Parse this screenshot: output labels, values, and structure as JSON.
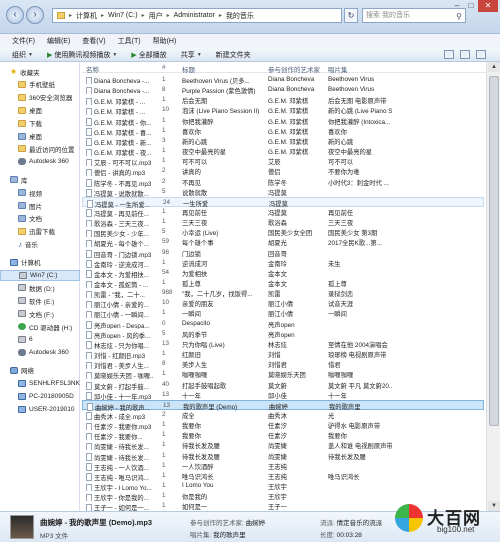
{
  "address": {
    "segments": [
      "计算机",
      "Win7 (C:)",
      "用户",
      "Administrator",
      "我的音乐"
    ],
    "search_placeholder": "搜索 我的音乐"
  },
  "menu": [
    "文件(F)",
    "编辑(E)",
    "查看(V)",
    "工具(T)",
    "帮助(H)"
  ],
  "toolbar": {
    "organize": "组织",
    "play_with": "使用腾讯视频播放",
    "play_all": "全部播放",
    "share": "共享",
    "new_folder": "新建文件夹"
  },
  "sidebar": [
    {
      "label": "收藏夹",
      "level": "group",
      "icon": "star"
    },
    {
      "label": "手机壁纸",
      "level": "child",
      "icon": "folder"
    },
    {
      "label": "360安全浏览器",
      "level": "child",
      "icon": "folder"
    },
    {
      "label": "桌面",
      "level": "child",
      "icon": "folder"
    },
    {
      "label": "下载",
      "level": "child",
      "icon": "folder"
    },
    {
      "label": "桌面",
      "level": "child",
      "icon": "lib"
    },
    {
      "label": "最近访问的位置",
      "level": "child",
      "icon": "folder"
    },
    {
      "label": "Autodesk 360",
      "level": "child",
      "icon": "cloud"
    },
    {
      "label": "库",
      "level": "group",
      "icon": "lib"
    },
    {
      "label": "视频",
      "level": "child",
      "icon": "lib"
    },
    {
      "label": "图片",
      "level": "child",
      "icon": "lib"
    },
    {
      "label": "文档",
      "level": "child",
      "icon": "lib"
    },
    {
      "label": "迅雷下载",
      "level": "child",
      "icon": "folder"
    },
    {
      "label": "音乐",
      "level": "child",
      "icon": "music"
    },
    {
      "label": "计算机",
      "level": "group",
      "icon": "pc"
    },
    {
      "label": "Win7 (C:)",
      "level": "child",
      "icon": "drive"
    },
    {
      "label": "数据 (D:)",
      "level": "child",
      "icon": "drive"
    },
    {
      "label": "软件 (E:)",
      "level": "child",
      "icon": "drive"
    },
    {
      "label": "文档 (F:)",
      "level": "child",
      "icon": "drive"
    },
    {
      "label": "CD 驱动器 (H:)",
      "level": "child",
      "icon": "green"
    },
    {
      "label": "6",
      "level": "child",
      "icon": "drive"
    },
    {
      "label": "Autodesk 360",
      "level": "child",
      "icon": "cloud"
    },
    {
      "label": "网络",
      "level": "group",
      "icon": "net"
    },
    {
      "label": "SENHLRFSL3NK",
      "level": "child",
      "icon": "pc"
    },
    {
      "label": "PC-20180905D",
      "level": "child",
      "icon": "pc"
    },
    {
      "label": "USER-2019010",
      "level": "child",
      "icon": "pc"
    }
  ],
  "columns": {
    "name": "名称",
    "num": "#",
    "title": "标题",
    "artist": "参与创作的艺术家",
    "album": "唱片集"
  },
  "rows": [
    {
      "name": "Diana Boncheva -...",
      "num": "1",
      "title": "Beethoven Virus (贝多...",
      "artist": "Diana Boncheva",
      "album": "Beethoven Virus"
    },
    {
      "name": "Diana Boncheva -...",
      "num": "8",
      "title": "Purple Passion (紫色激情)",
      "artist": "Diana Boncheva",
      "album": "Beethoven Virus"
    },
    {
      "name": "G.E.M. 邓紫棋 - ...",
      "num": "1",
      "title": "后会无期",
      "artist": "G.E.M. 邓紫棋",
      "album": "后会无期 电影原声带"
    },
    {
      "name": "G.E.M. 邓紫棋 - ...",
      "num": "10",
      "title": "泡沫 (Live Piano Session II)",
      "artist": "G.E.M. 邓紫棋",
      "album": "新的心跳 (Live Piano Sessi..."
    },
    {
      "name": "G.E.M. 邓紫棋 - 你...",
      "num": "1",
      "title": "你把我灌醉",
      "artist": "G.E.M. 邓紫棋",
      "album": "你把我灌醉 (Intoxica..."
    },
    {
      "name": "G.E.M. 邓紫棋 - 喜...",
      "num": "1",
      "title": "喜欢你",
      "artist": "G.E.M. 邓紫棋",
      "album": "喜欢你"
    },
    {
      "name": "G.E.M. 邓紫棋 - 新...",
      "num": "3",
      "title": "新的心跳",
      "artist": "G.E.M. 邓紫棋",
      "album": "新的心跳"
    },
    {
      "name": "G.E.M. 邓紫棋 - 夜...",
      "num": "1",
      "title": "夜空中最亮的星",
      "artist": "G.E.M. 邓紫棋",
      "album": "夜空中最亮的星"
    },
    {
      "name": "艾辰 - 可不可以.mp3",
      "num": "1",
      "title": "可不可以",
      "artist": "艾辰",
      "album": "可不可以"
    },
    {
      "name": "僧侣 - 讲真的.mp3",
      "num": "2",
      "title": "讲真的",
      "artist": "僧侣",
      "album": "不要你为难"
    },
    {
      "name": "陈学冬 - 不再见.mp3",
      "num": "2",
      "title": "不再见",
      "artist": "陈学冬",
      "album": "小时代3：刺金时代 ..."
    },
    {
      "name": "冯提莫 - 说散就散...",
      "num": "5",
      "title": "说散就散",
      "artist": "冯提莫",
      "album": ""
    },
    {
      "name": "冯提莫 - 一生所爱...",
      "num": "24",
      "title": "一生所爱",
      "artist": "冯提莫",
      "album": ""
    },
    {
      "name": "冯提莫 - 再见前任...",
      "num": "1",
      "title": "再见前任",
      "artist": "冯提莫",
      "album": "再见前任"
    },
    {
      "name": "歌浴森 - 三天三夜...",
      "num": "1",
      "title": "三天三夜",
      "artist": "歌浴森",
      "album": "三天三夜"
    },
    {
      "name": "国民美少女 - 少年...",
      "num": "5",
      "title": "小幸运 (Live)",
      "artist": "国民美少女全团",
      "album": "国民美少女 第3期"
    },
    {
      "name": "胡夏光 - 每个雄个...",
      "num": "59",
      "title": "每个雄个事",
      "artist": "胡夏光",
      "album": "2017全民K歌...第..."
    },
    {
      "name": "回音哥 - 门边锁.mp3",
      "num": "98",
      "title": "门边锁",
      "artist": "回音哥",
      "album": ""
    },
    {
      "name": "金南玲 - 逆流成河...",
      "num": "1",
      "title": "逆流成河",
      "artist": "金南玲",
      "album": "未生"
    },
    {
      "name": "金本文 - 为爱相扶...",
      "num": "54",
      "title": "为爱相扶",
      "artist": "金本文",
      "album": ""
    },
    {
      "name": "金本文 - 孤蛇筒 - ...",
      "num": "1",
      "title": "孤上尊",
      "artist": "金本文",
      "album": "孤上尊"
    },
    {
      "name": "凯雷 - \"我，二十...",
      "num": "988",
      "title": "\"我，二十几岁，找饭得...",
      "artist": "凯雷",
      "album": "录狱剑恋"
    },
    {
      "name": "丽江小倩 - 亲爱的...",
      "num": "10",
      "title": "亲爱的朋友",
      "artist": "丽江小倩",
      "album": "试音天涯"
    },
    {
      "name": "丽江小倩 - 一瞬间...",
      "num": "1",
      "title": "一瞬间",
      "artist": "丽江小倩",
      "album": "一瞬间"
    },
    {
      "name": "亮声open - Despa...",
      "num": "0",
      "title": "Despacito",
      "artist": "亮声open",
      "album": ""
    },
    {
      "name": "亮声open - 风的季...",
      "num": "5",
      "title": "风的季节",
      "artist": "亮声open",
      "album": ""
    },
    {
      "name": "林志炫 - 只为你唱...",
      "num": "13",
      "title": "只为你唱 (Live)",
      "artist": "林志炫",
      "album": "至情在他 2004演唱会"
    },
    {
      "name": "刘惜 - 红颜旧.mp3",
      "num": "1",
      "title": "红颜旧",
      "artist": "刘惜",
      "album": "琅琊榜 电视剧原声带"
    },
    {
      "name": "刘惜君 - 美步人生...",
      "num": "8",
      "title": "美步人生",
      "artist": "刘惜君",
      "album": "惜君"
    },
    {
      "name": "莫晓娱乐天团 - 咖喱...",
      "num": "1",
      "title": "咖喱咖喱",
      "artist": "莫晓娱乐天团",
      "album": "咖喱咖喱"
    },
    {
      "name": "莫文蔚 - 打起手鼓...",
      "num": "40",
      "title": "打起手鼓唱起歌",
      "artist": "莫文蔚",
      "album": "莫文蔚 平凡 莫文蔚20..."
    },
    {
      "name": "邱小佳 - 十一年.mp3",
      "num": "13",
      "title": "十一年",
      "artist": "邱小佳",
      "album": "十一年"
    },
    {
      "name": "曲婉婷 - 我的歌声...",
      "num": "13",
      "title": "我的歌声里 (Demo)",
      "artist": "曲婉婷",
      "album": "我的歌声里"
    },
    {
      "name": "曲秀沐 - 成全.mp3",
      "num": "2",
      "title": "成全",
      "artist": "曲秀沐",
      "album": "光"
    },
    {
      "name": "任素汐 - 我要你.mp3",
      "num": "1",
      "title": "我要你",
      "artist": "任素汐",
      "album": "驴得水 电影原声带"
    },
    {
      "name": "任素汐 - 我要你...",
      "num": "1",
      "title": "我要你",
      "artist": "任素汐",
      "album": "我要你"
    },
    {
      "name": "尚雯婕 - 待我长发...",
      "num": "1",
      "title": "待我长发及腰",
      "artist": "尚雯婕",
      "album": "盖人和谁 电视剧原声带"
    },
    {
      "name": "尚雯婕 - 待我长发...",
      "num": "1",
      "title": "待我长发及腰",
      "artist": "尚雯婕",
      "album": "待我长发及腰"
    },
    {
      "name": "王志纯 - 一人饮酒...",
      "num": "1",
      "title": "一人饮酒醉",
      "artist": "王志纯",
      "album": ""
    },
    {
      "name": "王志纯 - 唯马识鸿...",
      "num": "1",
      "title": "唯马识鸿长",
      "artist": "王志纯",
      "album": "唯马识鸿长"
    },
    {
      "name": "王欣宇 - I Lomo Yo...",
      "num": "1",
      "title": "I Lomo You",
      "artist": "王欣宇",
      "album": ""
    },
    {
      "name": "王欣宇 - 你是我的...",
      "num": "1",
      "title": "你是我的",
      "artist": "王欣宇",
      "album": ""
    },
    {
      "name": "王子一 - 如何是一...",
      "num": "1",
      "title": "如何是一",
      "artist": "王子一",
      "album": ""
    }
  ],
  "selected_row_index": 32,
  "hover_row_index": 12,
  "details": {
    "title": "曲婉婷 - 我的歌声里 (Demo).mp3",
    "type": "MP3 文件",
    "artist_label": "参与创作的艺术家:",
    "artist": "曲婉婷",
    "album_label": "唱片集:",
    "album": "我的歌声里",
    "genre_label": "流派:",
    "genre": "情定音乐的流派",
    "length_label": "长度:",
    "length": "00:03:28"
  },
  "watermark": {
    "text": "大百网",
    "url": "big100.net"
  }
}
